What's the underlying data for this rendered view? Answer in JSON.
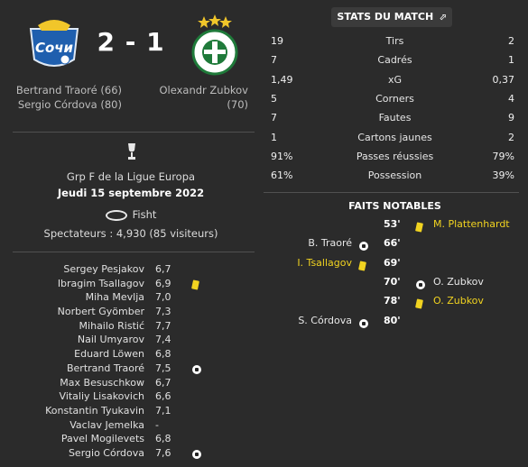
{
  "match": {
    "home_score": "2",
    "separator": "-",
    "away_score": "1",
    "home_scorers": [
      "Bertrand Traoré (66)",
      "Sergio Córdova (80)"
    ],
    "away_scorers": [
      "Olexandr Zubkov (70)"
    ],
    "competition": "Grp F de la Ligue Europa",
    "date": "Jeudi 15 septembre 2022",
    "stadium": "Fisht",
    "spectators": "Spectateurs : 4,930 (85 visiteurs)"
  },
  "players": [
    {
      "name": "Sergey Pesjakov",
      "rating": "6,7",
      "event": ""
    },
    {
      "name": "Ibragim Tsallagov",
      "rating": "6,9",
      "event": "yellow-card"
    },
    {
      "name": "Miha Mevlja",
      "rating": "7,0",
      "event": ""
    },
    {
      "name": "Norbert Gyömber",
      "rating": "7,3",
      "event": ""
    },
    {
      "name": "Mihailo Ristić",
      "rating": "7,7",
      "event": ""
    },
    {
      "name": "Nail Umyarov",
      "rating": "7,4",
      "event": ""
    },
    {
      "name": "Eduard Löwen",
      "rating": "6,8",
      "event": ""
    },
    {
      "name": "Bertrand Traoré",
      "rating": "7,5",
      "event": "goal"
    },
    {
      "name": "Max Besuschkow",
      "rating": "6,7",
      "event": ""
    },
    {
      "name": "Vitaliy Lisakovich",
      "rating": "6,6",
      "event": ""
    },
    {
      "name": "Konstantin Tyukavin",
      "rating": "7,1",
      "event": ""
    },
    {
      "name": "Vaclav Jemelka",
      "rating": "-",
      "event": ""
    },
    {
      "name": "Pavel Mogilevets",
      "rating": "6,8",
      "event": ""
    },
    {
      "name": "Sergio Córdova",
      "rating": "7,6",
      "event": "goal"
    }
  ],
  "stats_button": "STATS DU MATCH",
  "stats": [
    {
      "label": "Tirs",
      "home": "19",
      "away": "2"
    },
    {
      "label": "Cadrés",
      "home": "7",
      "away": "1"
    },
    {
      "label": "xG",
      "home": "1,49",
      "away": "0,37"
    },
    {
      "label": "Corners",
      "home": "5",
      "away": "4"
    },
    {
      "label": "Fautes",
      "home": "7",
      "away": "9"
    },
    {
      "label": "Cartons jaunes",
      "home": "1",
      "away": "2"
    },
    {
      "label": "Passes réussies",
      "home": "91%",
      "away": "79%"
    },
    {
      "label": "Possession",
      "home": "61%",
      "away": "39%"
    }
  ],
  "notable_title": "FAITS NOTABLES",
  "events": [
    {
      "minute": "53'",
      "side": "away",
      "player": "M. Plattenhardt",
      "type": "yellow-card",
      "highlight": true
    },
    {
      "minute": "66'",
      "side": "home",
      "player": "B. Traoré",
      "type": "goal",
      "highlight": false
    },
    {
      "minute": "69'",
      "side": "home",
      "player": "I. Tsallagov",
      "type": "yellow-card",
      "highlight": true
    },
    {
      "minute": "70'",
      "side": "away",
      "player": "O. Zubkov",
      "type": "goal",
      "highlight": false
    },
    {
      "minute": "78'",
      "side": "away",
      "player": "O. Zubkov",
      "type": "yellow-card",
      "highlight": true
    },
    {
      "minute": "80'",
      "side": "home",
      "player": "S. Córdova",
      "type": "goal",
      "highlight": false
    }
  ],
  "colors": {
    "background": "#2b2b2b",
    "yellow_card": "#f1d320",
    "home_blue": "#1f5fae",
    "away_green": "#1f7a3a"
  }
}
